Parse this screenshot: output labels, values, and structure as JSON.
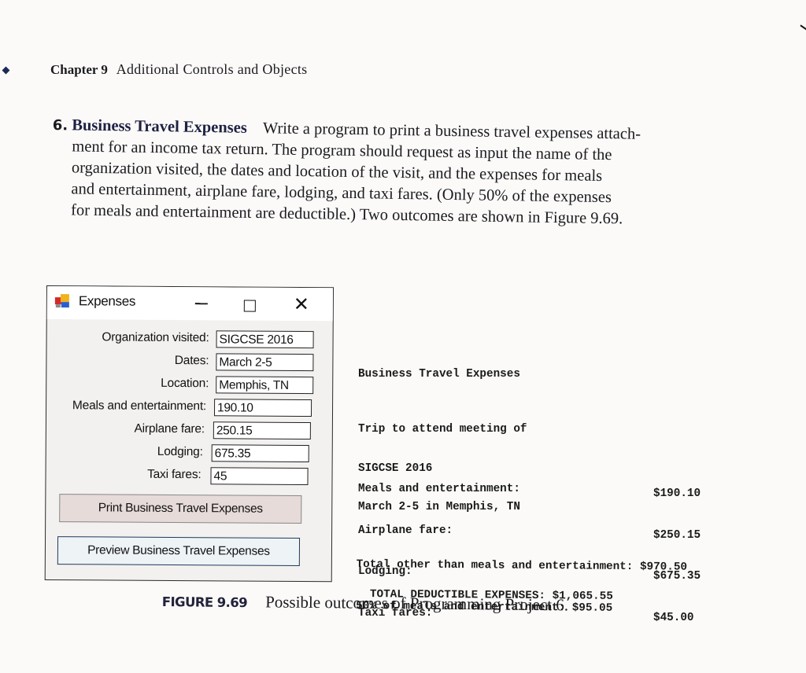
{
  "page": {
    "chapter_label": "Chapter 9",
    "chapter_title": "Additional Controls and Objects"
  },
  "problem": {
    "number": "6.",
    "title": "Business Travel Expenses",
    "lines": [
      "Write a program to print a business travel expenses attach-",
      "ment for an income tax return. The program should request as input the name of the",
      "organization visited, the dates and location of the visit, and the expenses for meals",
      "and entertainment, airplane fare, lodging, and taxi fares. (Only 50% of the expenses",
      "for meals and entertainment are deductible.) Two outcomes are shown in Figure 9.69."
    ]
  },
  "window": {
    "title": "Expenses",
    "icons": {
      "app": "form-app-icon",
      "minimize": "minimize-icon",
      "maximize": "maximize-icon",
      "close": "close-icon"
    },
    "close_glyph": "✕",
    "fields": [
      {
        "label": "Organization visited:",
        "value": "SIGCSE 2016"
      },
      {
        "label": "Dates:",
        "value": "March 2-5"
      },
      {
        "label": "Location:",
        "value": "Memphis, TN"
      },
      {
        "label": "Meals and entertainment:",
        "value": "190.10"
      },
      {
        "label": "Airplane fare:",
        "value": "250.15"
      },
      {
        "label": "Lodging:",
        "value": "675.35"
      },
      {
        "label": "Taxi fares:",
        "value": "45"
      }
    ],
    "buttons": {
      "print": "Print Business Travel Expenses",
      "preview": "Preview Business Travel Expenses"
    }
  },
  "output": {
    "heading": "Business Travel Expenses",
    "trip_lines": [
      "Trip to attend meeting of",
      "SIGCSE 2016",
      "March 2-5 in Memphis, TN"
    ],
    "expense_labels": [
      "Meals and entertainment:",
      "Airplane fare:",
      "Lodging:",
      "Taxi fares:"
    ],
    "expense_values": [
      "$190.10",
      "$250.15",
      "$675.35",
      "$45.00"
    ],
    "total_other_label": "Total other than meals and entertainment:",
    "total_other_value": "$970.50",
    "half_meals_label": "50% of meals and entertainment:",
    "half_meals_value": "$95.05",
    "total_label": "TOTAL DEDUCTIBLE EXPENSES:",
    "total_value": "$1,065.55"
  },
  "figure": {
    "label": "FIGURE 9.69",
    "caption": "Possible outcomes of Programming Project 6."
  }
}
